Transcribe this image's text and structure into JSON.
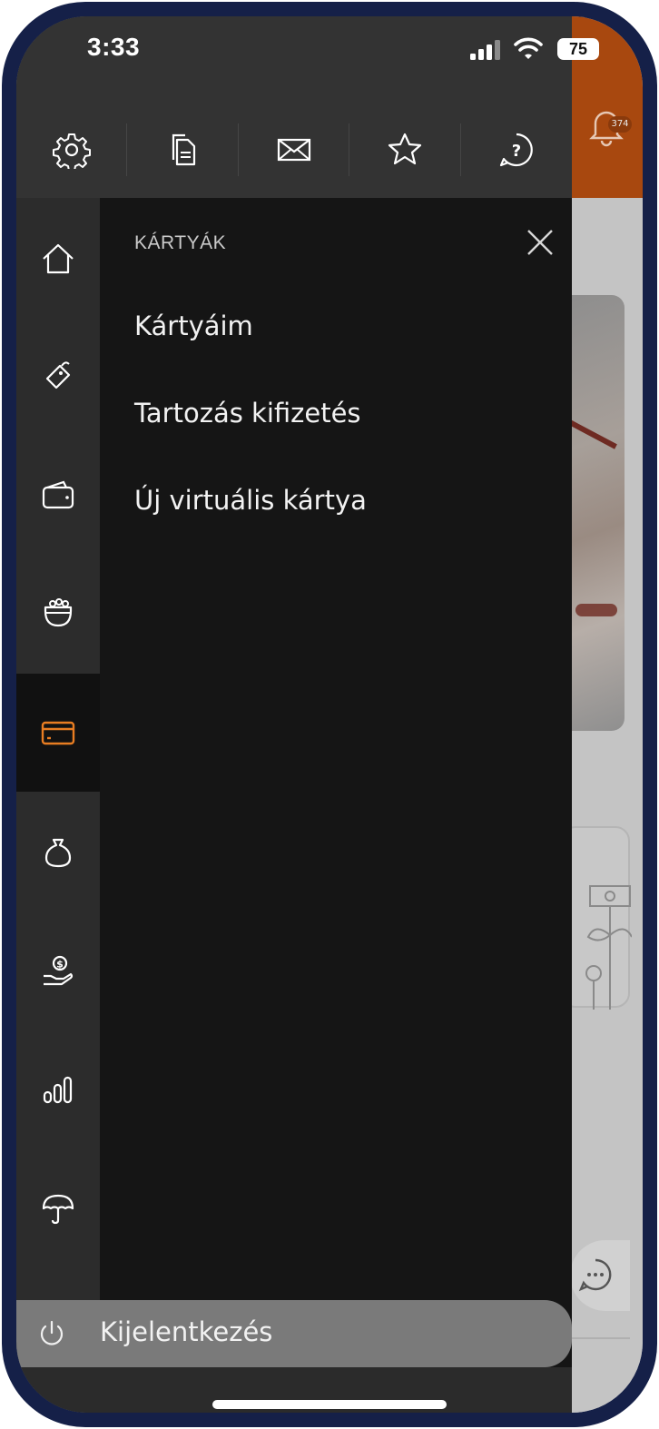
{
  "status_bar": {
    "time": "3:33",
    "battery": "75"
  },
  "toolbar": {
    "items": [
      {
        "icon": "gear-icon"
      },
      {
        "icon": "document-icon"
      },
      {
        "icon": "mail-icon"
      },
      {
        "icon": "star-icon"
      },
      {
        "icon": "help-icon"
      }
    ]
  },
  "rail": {
    "active_index": 4,
    "accent_color": "#e87d22",
    "items": [
      {
        "icon": "home-icon"
      },
      {
        "icon": "tag-icon"
      },
      {
        "icon": "wallet-icon"
      },
      {
        "icon": "piggy-pot-icon"
      },
      {
        "icon": "credit-card-icon"
      },
      {
        "icon": "money-bag-icon"
      },
      {
        "icon": "hand-coin-icon"
      },
      {
        "icon": "bar-chart-icon"
      },
      {
        "icon": "umbrella-icon"
      }
    ]
  },
  "submenu": {
    "title": "KÁRTYÁK",
    "items": [
      {
        "label": "Kártyáim"
      },
      {
        "label": "Tartozás kifizetés"
      },
      {
        "label": "Új virtuális kártya"
      }
    ]
  },
  "logout": {
    "label": "Kijelentkezés"
  },
  "background_app": {
    "notification_count": "374",
    "header_color": "#a8480f"
  }
}
